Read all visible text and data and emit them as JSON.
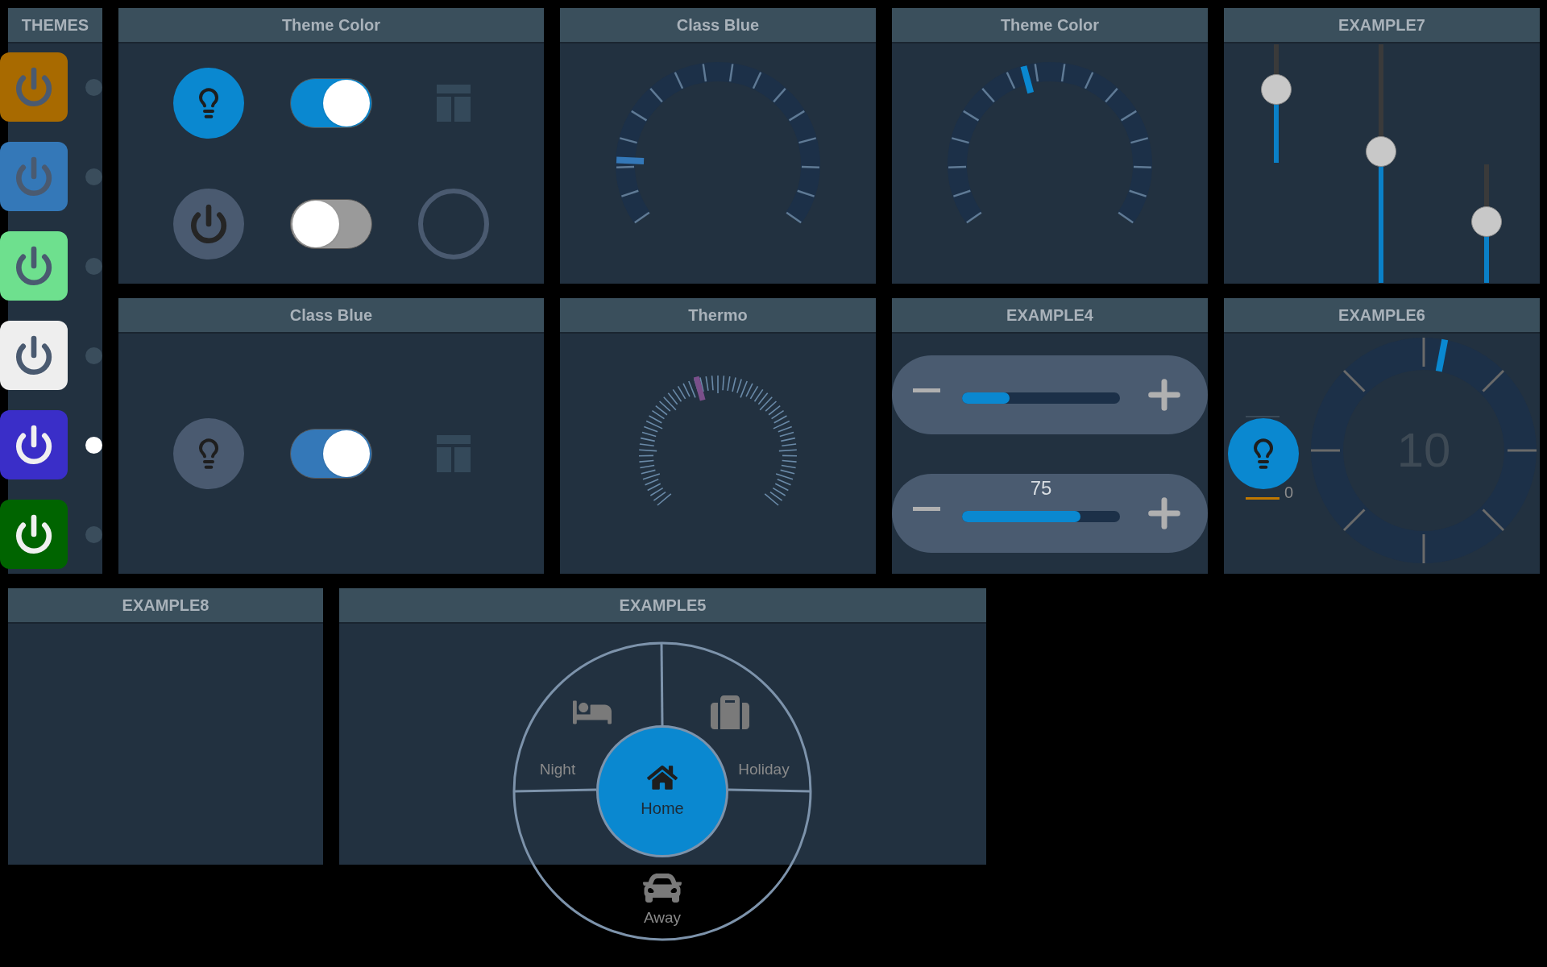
{
  "themes": {
    "title": "THEMES",
    "items": [
      {
        "color": "#a86a00",
        "selected": false
      },
      {
        "color": "#3478b8",
        "selected": false
      },
      {
        "color": "#6ee08e",
        "selected": false
      },
      {
        "color": "#eeeeee",
        "selected": false
      },
      {
        "color": "#3a2ec8",
        "selected": true
      },
      {
        "color": "#006400",
        "selected": false
      }
    ]
  },
  "switch_panels": [
    {
      "title": "Theme Color",
      "color": "#0a88d0",
      "controls": [
        {
          "kind": "bulb",
          "on": true
        },
        {
          "kind": "toggle",
          "on": true
        },
        {
          "kind": "layout"
        },
        {
          "kind": "power",
          "on": false
        },
        {
          "kind": "toggle",
          "on": false
        },
        {
          "kind": "ring"
        }
      ]
    },
    {
      "title": "Class Blue",
      "color": "#3478b8",
      "controls": [
        {
          "kind": "bulb",
          "on": false
        },
        {
          "kind": "toggle",
          "on": true
        },
        {
          "kind": "layout"
        }
      ]
    }
  ],
  "gauges": [
    {
      "title": "Class Blue",
      "color": "#3478b8",
      "level": 0.15
    },
    {
      "title": "Theme Color",
      "color": "#0a88d0",
      "level": 0.44
    }
  ],
  "thermo": {
    "title": "Thermo",
    "color": "#7a4f8a",
    "level": 0.44
  },
  "example7": {
    "title": "EXAMPLE7",
    "sliders": [
      {
        "level": 0.62
      },
      {
        "level": 0.55
      },
      {
        "level": 0.52
      }
    ]
  },
  "example4": {
    "title": "EXAMPLE4",
    "steppers": [
      {
        "level": 0.3
      },
      {
        "level": 0.75,
        "reading": "75"
      }
    ]
  },
  "example6": {
    "title": "EXAMPLE6",
    "bulb": {
      "on": true
    },
    "slider": {
      "level": 0,
      "reading": "0"
    },
    "dial": {
      "level": 0.53,
      "reading": "10"
    }
  },
  "example8": {
    "title": "EXAMPLE8"
  },
  "example5": {
    "title": "EXAMPLE5",
    "center": {
      "label": "Home",
      "selected": true
    },
    "items": [
      {
        "label": "Night",
        "selected": false
      },
      {
        "label": "Holiday",
        "selected": false
      },
      {
        "label": "Away",
        "selected": false
      }
    ]
  }
}
